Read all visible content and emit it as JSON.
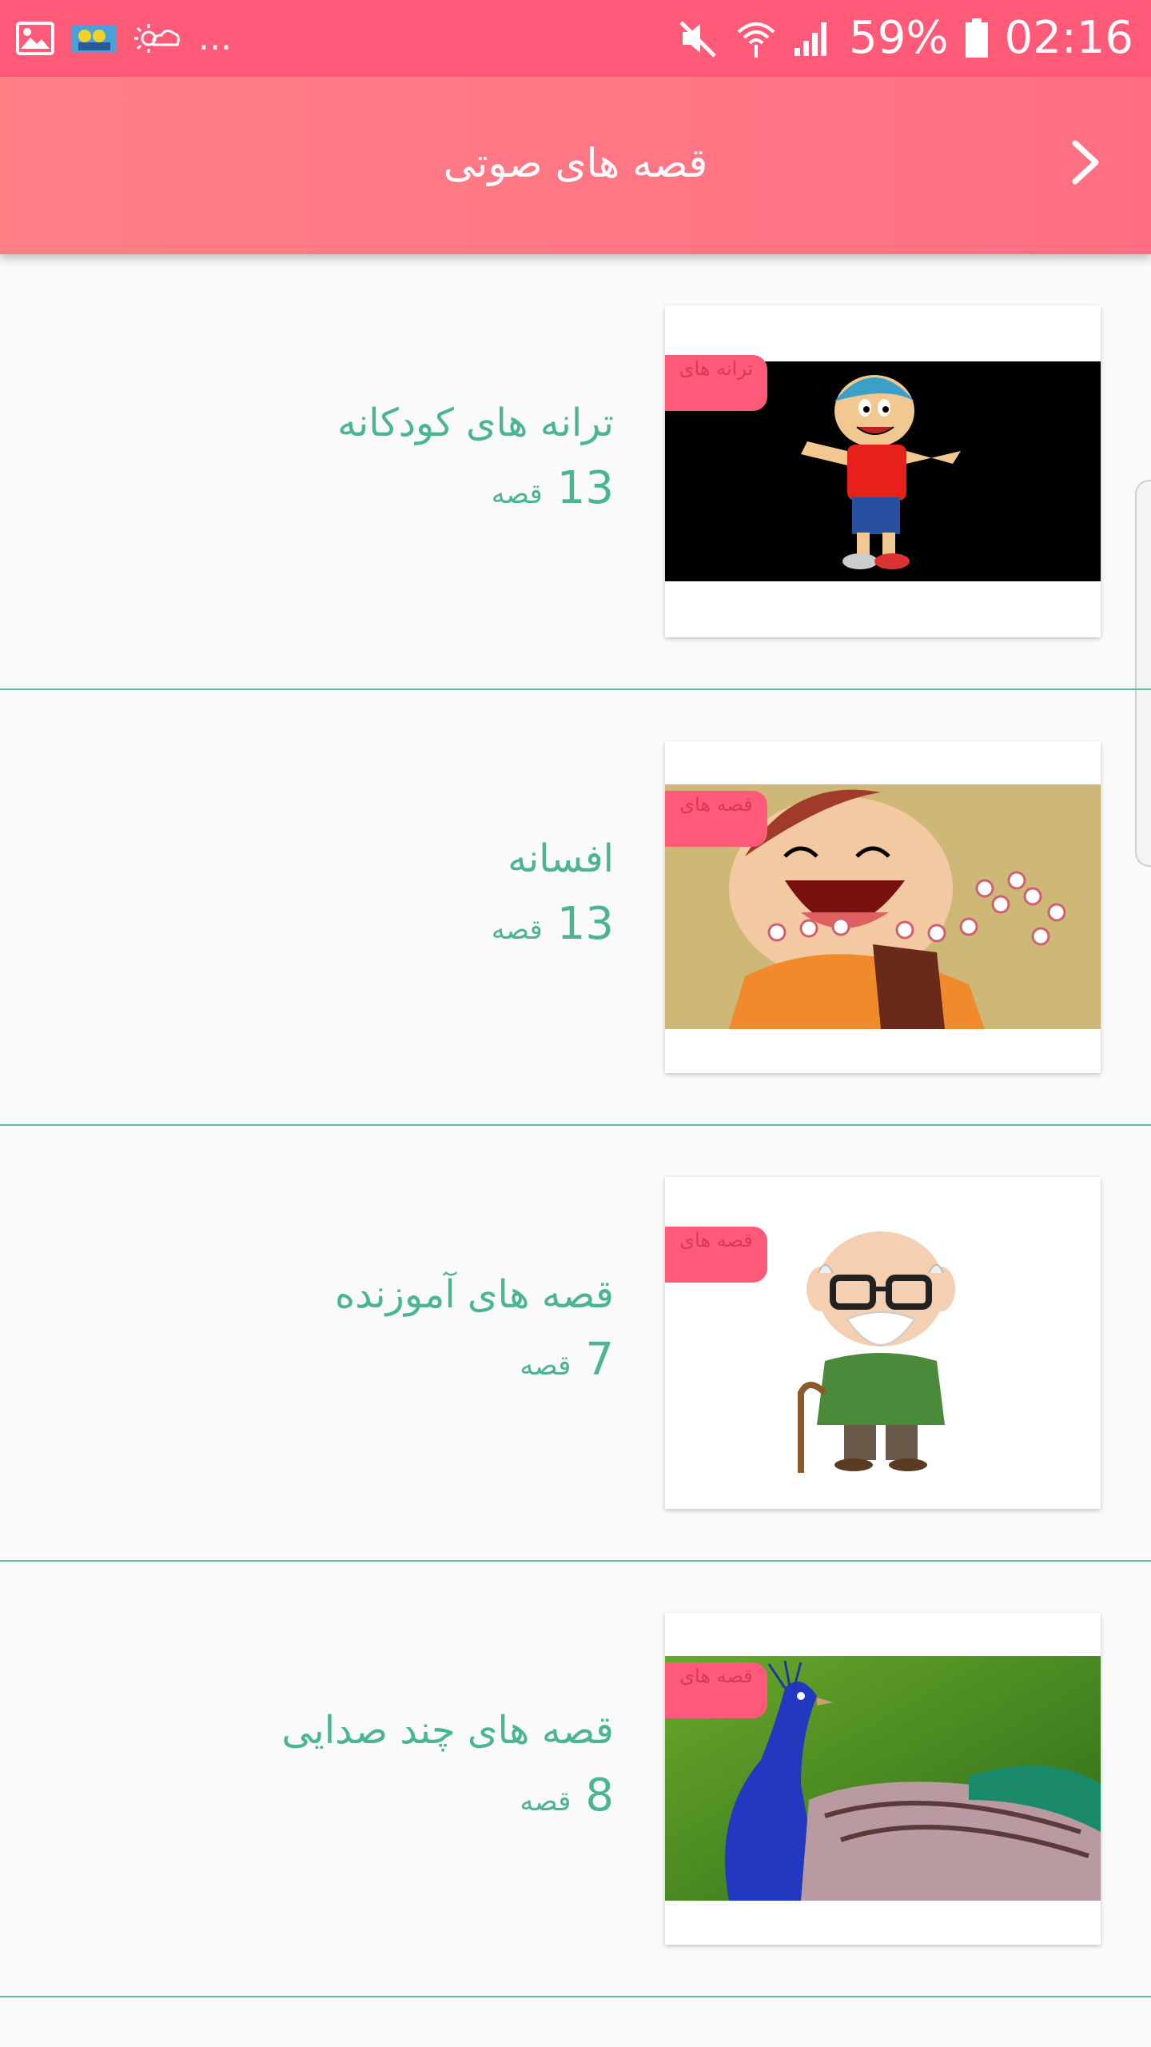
{
  "status_bar": {
    "battery": "59%",
    "time": "02:16",
    "more_indicator": "...",
    "icons": [
      "gallery-icon",
      "app-thumbnail-icon",
      "weather-icon",
      "mute-icon",
      "wifi-icon",
      "signal-icon",
      "battery-icon"
    ]
  },
  "header": {
    "title": "قصه های صوتی",
    "back_icon": "chevron-right-icon"
  },
  "colors": {
    "status_bar": "#ff5a78",
    "app_bar": "#ff7f87",
    "accent_text": "#4ab58e",
    "divider": "#64c09a",
    "tag": "#ff5a78"
  },
  "categories": [
    {
      "title": "ترانه های کودکانه",
      "count": "13",
      "unit": "قصه",
      "tag": "ترانه های",
      "image": "cartoon-boy-image"
    },
    {
      "title": "افسانه",
      "count": "13",
      "unit": "قصه",
      "tag": "قصه های",
      "image": "cartoon-character-image"
    },
    {
      "title": "قصه های آموزنده",
      "count": "7",
      "unit": "قصه",
      "tag": "قصه های",
      "image": "grandfather-cartoon-image"
    },
    {
      "title": "قصه های چند صدایی",
      "count": "8",
      "unit": "قصه",
      "tag": "قصه های",
      "image": "peacock-image"
    }
  ]
}
